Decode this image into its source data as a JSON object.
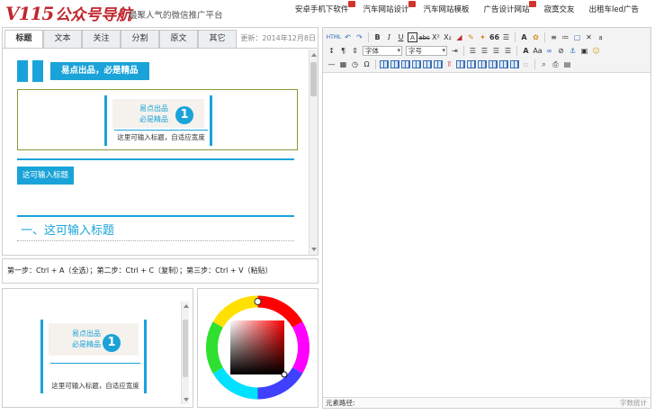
{
  "brand": {
    "logo_mark": "V115",
    "logo_cn": "公众号导航",
    "slogan": "最聚人气的微信推广平台",
    "accent_color": "#1aa3d8",
    "brand_color": "#c0262d"
  },
  "top_links": [
    {
      "label": "安卓手机下软件"
    },
    {
      "label": "汽车网站设计"
    },
    {
      "label": "汽车网站模板"
    },
    {
      "label": "广告设计网站"
    },
    {
      "label": "寂寞交友"
    },
    {
      "label": "出租车led广告"
    }
  ],
  "tabs": [
    {
      "label": "标题",
      "active": true
    },
    {
      "label": "文本",
      "active": false
    },
    {
      "label": "关注",
      "active": false
    },
    {
      "label": "分割",
      "active": false
    },
    {
      "label": "原文",
      "active": false
    },
    {
      "label": "其它",
      "active": false
    }
  ],
  "updated_text": "更新：2014年12月8日",
  "preview": {
    "ex1_title": "易点出品，必是精品",
    "ex2_line1": "易点出品",
    "ex2_line2": "必是精品",
    "ex2_number": "1",
    "ex2_caption": "这里可输入标题，自适应宽度",
    "ex3_title": "这可输入标题",
    "ex4_title": "一、这可输入标题"
  },
  "steps_text": "第一步：Ctrl + A（全选）；第二步：Ctrl + C（复制）；第三步：Ctrl + V（粘贴）",
  "selected_preview": {
    "line1": "易点出品",
    "line2": "必是精品",
    "number": "1",
    "caption": "这里可输入标题，自适应宽度"
  },
  "toolbar": {
    "html_label": "HTML",
    "font_family": "字体",
    "font_size": "字号",
    "bold": "B",
    "italic": "I",
    "underline": "U",
    "letter_a": "A",
    "omega": "Ω",
    "quote": "66"
  },
  "status": {
    "path_label": "元素路径:",
    "word_count_label": "字数统计"
  }
}
